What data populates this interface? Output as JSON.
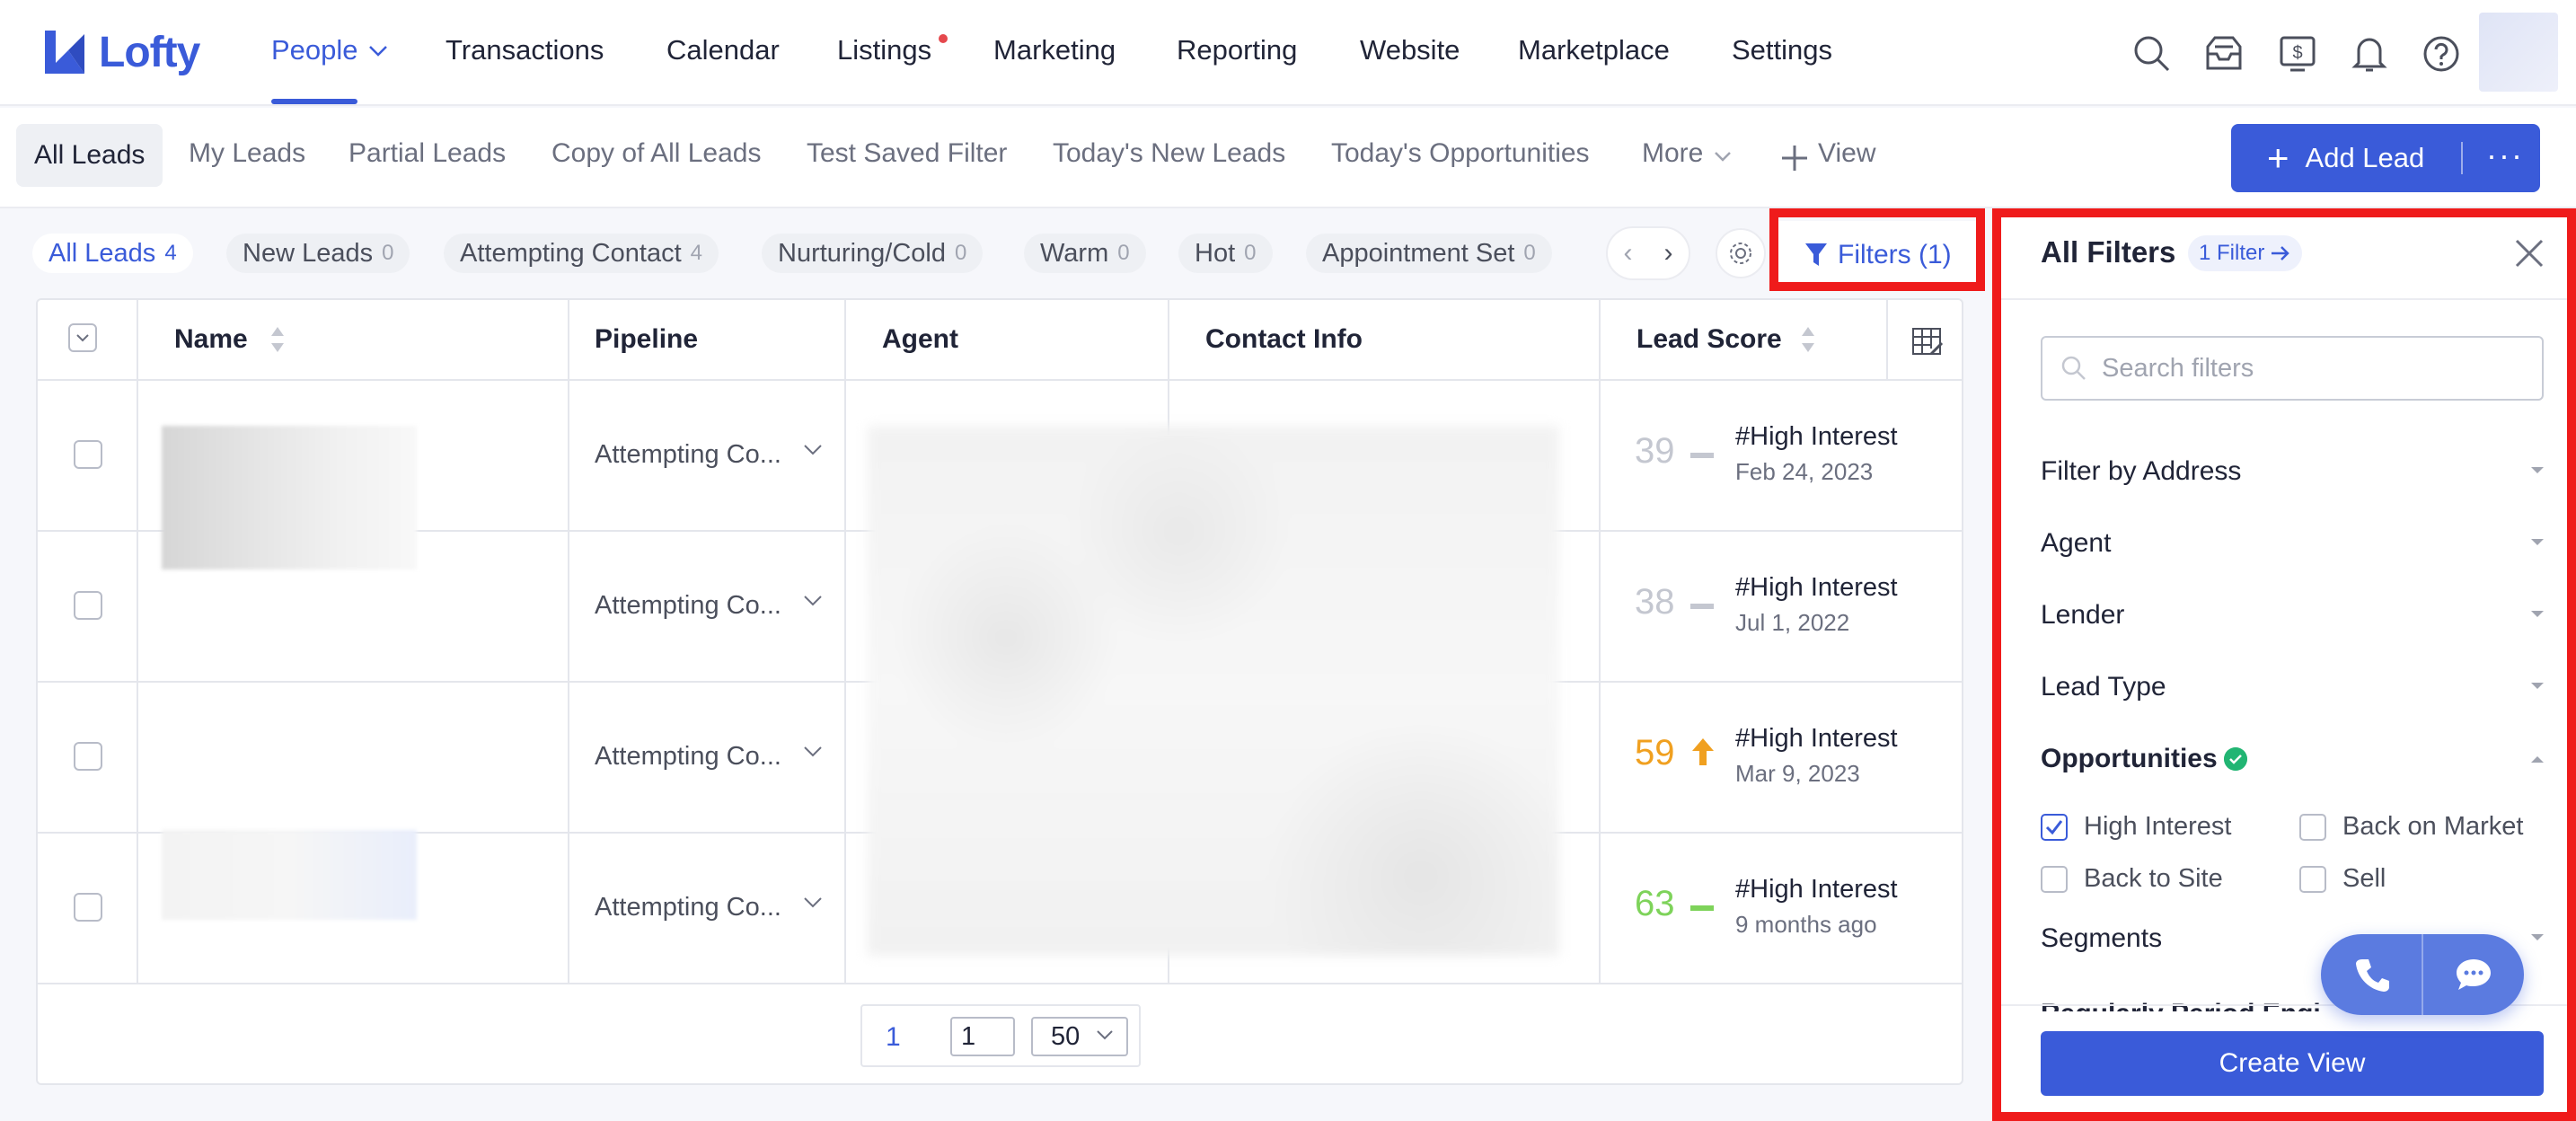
{
  "app": {
    "brand": "Lofty",
    "accent_color": "#3a5bd9",
    "highlight_color": "#ef1b1b"
  },
  "nav": {
    "items": [
      {
        "label": "People",
        "has_dropdown": true,
        "active": true
      },
      {
        "label": "Transactions"
      },
      {
        "label": "Calendar"
      },
      {
        "label": "Listings",
        "has_notification_dot": true
      },
      {
        "label": "Marketing"
      },
      {
        "label": "Reporting"
      },
      {
        "label": "Website"
      },
      {
        "label": "Marketplace"
      },
      {
        "label": "Settings"
      }
    ],
    "icons": [
      "search-icon",
      "inbox-icon",
      "billing-icon",
      "bell-icon",
      "help-icon"
    ]
  },
  "views": {
    "tabs": [
      "All Leads",
      "My Leads",
      "Partial Leads",
      "Copy of All Leads",
      "Test Saved Filter",
      "Today's New Leads",
      "Today's Opportunities",
      "More",
      "View"
    ],
    "active": "All Leads",
    "add_lead_label": "Add Lead"
  },
  "pipeline_chips": [
    {
      "label": "All Leads",
      "count": "4",
      "active": true
    },
    {
      "label": "New Leads",
      "count": "0"
    },
    {
      "label": "Attempting Contact",
      "count": "4"
    },
    {
      "label": "Nurturing/Cold",
      "count": "0"
    },
    {
      "label": "Warm",
      "count": "0"
    },
    {
      "label": "Hot",
      "count": "0"
    },
    {
      "label": "Appointment Set",
      "count": "0"
    }
  ],
  "filters_button": "Filters  (1)",
  "table": {
    "columns": [
      "Name",
      "Pipeline",
      "Agent",
      "Contact Info",
      "Lead Score"
    ],
    "rows": [
      {
        "pipeline": "Attempting Co...",
        "score": "39",
        "trend": "flat",
        "score_color": "#c4c7d0",
        "tag": "#High Interest",
        "date": "Feb 24, 2023"
      },
      {
        "pipeline": "Attempting Co...",
        "score": "38",
        "trend": "flat",
        "score_color": "#c4c7d0",
        "tag": "#High Interest",
        "date": "Jul 1, 2022"
      },
      {
        "pipeline": "Attempting Co...",
        "score": "59",
        "trend": "up",
        "score_color": "#f0a020",
        "tag": "#High Interest",
        "date": "Mar 9, 2023"
      },
      {
        "pipeline": "Attempting Co...",
        "score": "63",
        "trend": "flat",
        "score_color": "#7ed35a",
        "tag": "#High Interest",
        "date": "9 months ago"
      }
    ],
    "pagination": {
      "current": "1",
      "page_input": "1",
      "page_size": "50"
    }
  },
  "filters_panel": {
    "title": "All Filters",
    "badge": "1 Filter",
    "search_placeholder": "Search filters",
    "sections": [
      "Filter by Address",
      "Agent",
      "Lender",
      "Lead Type"
    ],
    "opportunities": {
      "title": "Opportunities",
      "options": [
        {
          "label": "High Interest",
          "checked": true
        },
        {
          "label": "Back on Market",
          "checked": false
        },
        {
          "label": "Back to Site",
          "checked": false
        },
        {
          "label": "Sell",
          "checked": false
        }
      ]
    },
    "segments_label": "Segments",
    "cut_off_label": "Regularly Period Engi...",
    "create_view_label": "Create View"
  }
}
